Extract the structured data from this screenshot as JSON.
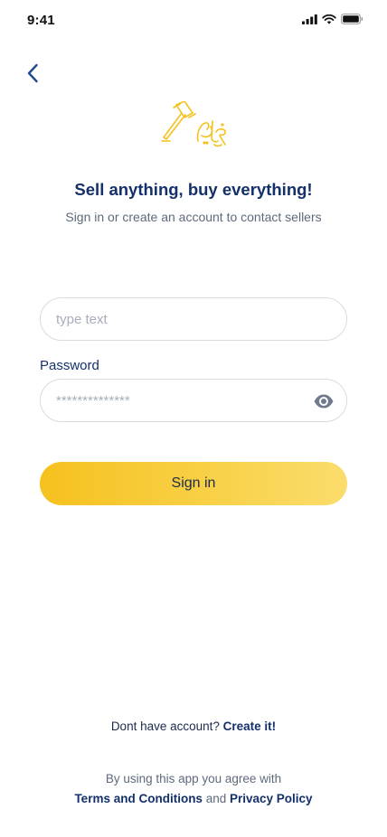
{
  "status_bar": {
    "time": "9:41",
    "icons": [
      "signal-icon",
      "wifi-icon",
      "battery-icon"
    ]
  },
  "nav": {
    "back_icon": "chevron-left-icon"
  },
  "logo": {
    "name": "gavel-logo",
    "text": "على السوق"
  },
  "header": {
    "title": "Sell anything, buy everything!",
    "subtitle": "Sign in or create an account to contact sellers"
  },
  "form": {
    "email": {
      "value": "",
      "placeholder": "type text"
    },
    "password": {
      "label": "Password",
      "placeholder": "**************",
      "visibility_icon": "eye-icon"
    },
    "submit_label": "Sign in"
  },
  "footer": {
    "create_prompt": "Dont have account?",
    "create_link": "Create it!",
    "legal_prefix": "By using this app you agree with",
    "terms_link": "Terms and Conditions",
    "and_text": "and",
    "privacy_link": "Privacy Policy"
  },
  "colors": {
    "primary_text": "#13306b",
    "secondary_text": "#5e6a7c",
    "accent": "#f5c11d",
    "border": "#d8dbe0"
  }
}
